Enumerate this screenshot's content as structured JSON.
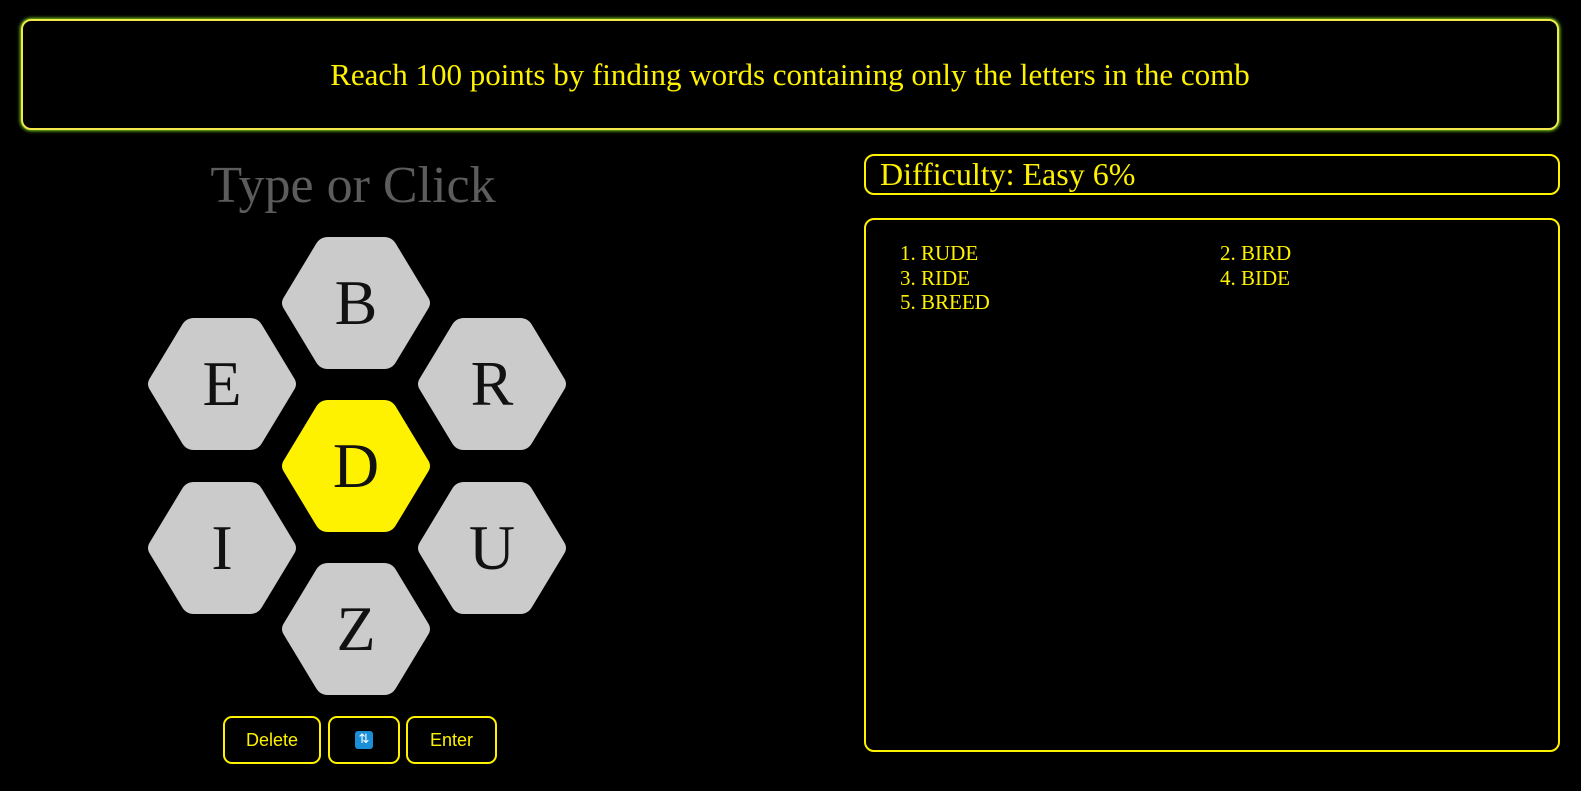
{
  "banner": {
    "message": "Reach 100 points by finding words containing only the letters in the comb"
  },
  "input": {
    "placeholder": "Type or Click"
  },
  "comb": {
    "center": {
      "letter": "D",
      "color": "#fff200"
    },
    "outer_color": "#cbcbcb",
    "outer": [
      {
        "position": "top",
        "letter": "B"
      },
      {
        "position": "upper-left",
        "letter": "E"
      },
      {
        "position": "upper-right",
        "letter": "R"
      },
      {
        "position": "lower-left",
        "letter": "I"
      },
      {
        "position": "lower-right",
        "letter": "U"
      },
      {
        "position": "bottom",
        "letter": "Z"
      }
    ]
  },
  "controls": {
    "delete_label": "Delete",
    "shuffle_icon": "shuffle-icon",
    "enter_label": "Enter"
  },
  "status": {
    "difficulty_text": "Difficulty: Easy 6%"
  },
  "found_words": [
    "1. RUDE",
    "2. BIRD",
    "3. RIDE",
    "4. BIDE",
    "5. BREED"
  ],
  "theme": {
    "accent": "#fff200",
    "glow": "#7ed321",
    "background": "#000000"
  }
}
